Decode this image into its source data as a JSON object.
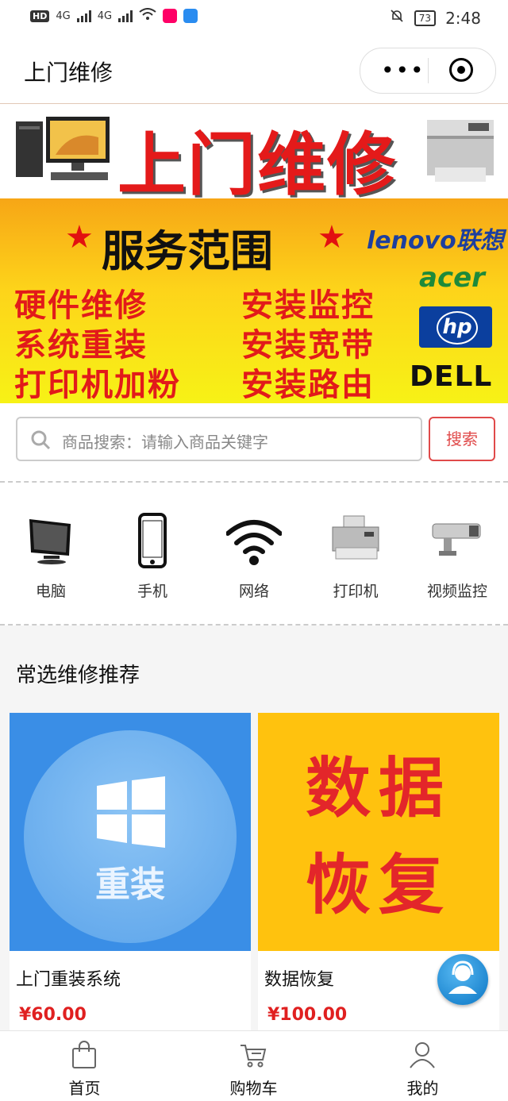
{
  "status_bar": {
    "left_badge": "HD",
    "network1": "4G",
    "network2": "4G",
    "battery": "73",
    "time": "2:48"
  },
  "nav": {
    "title": "上门维修",
    "more_icon": "more-dots-icon",
    "close_icon": "target-icon"
  },
  "banner": {
    "title": "上门维修",
    "service_title": "服务范围",
    "services": [
      "硬件维修",
      "系统重装",
      "打印机加粉",
      "安装监控",
      "安装宽带",
      "安装路由"
    ],
    "brands": [
      "lenovo联想",
      "acer",
      "hp",
      "DELL"
    ]
  },
  "search": {
    "placeholder": "商品搜索：请输入商品关键字",
    "button": "搜索"
  },
  "categories": [
    {
      "label": "电脑",
      "icon": "monitor-icon"
    },
    {
      "label": "手机",
      "icon": "phone-icon"
    },
    {
      "label": "网络",
      "icon": "wifi-icon"
    },
    {
      "label": "打印机",
      "icon": "printer-icon"
    },
    {
      "label": "视频监控",
      "icon": "camera-icon"
    }
  ],
  "recommend": {
    "title": "常选维修推荐",
    "items": [
      {
        "name": "上门重装系统",
        "price": "¥60.00",
        "image_text": "重装"
      },
      {
        "name": "数据恢复",
        "price": "¥100.00",
        "image_text_line1": "数据",
        "image_text_line2": "恢复"
      }
    ]
  },
  "tabbar": [
    {
      "label": "首页",
      "icon": "bag-icon"
    },
    {
      "label": "购物车",
      "icon": "cart-icon"
    },
    {
      "label": "我的",
      "icon": "user-icon"
    }
  ],
  "colors": {
    "accent_red": "#e04a4a",
    "price_red": "#e02020",
    "banner_yellow": "#fdd41a",
    "card_blue": "#3a8ee6",
    "card_yellow": "#ffc20e"
  }
}
